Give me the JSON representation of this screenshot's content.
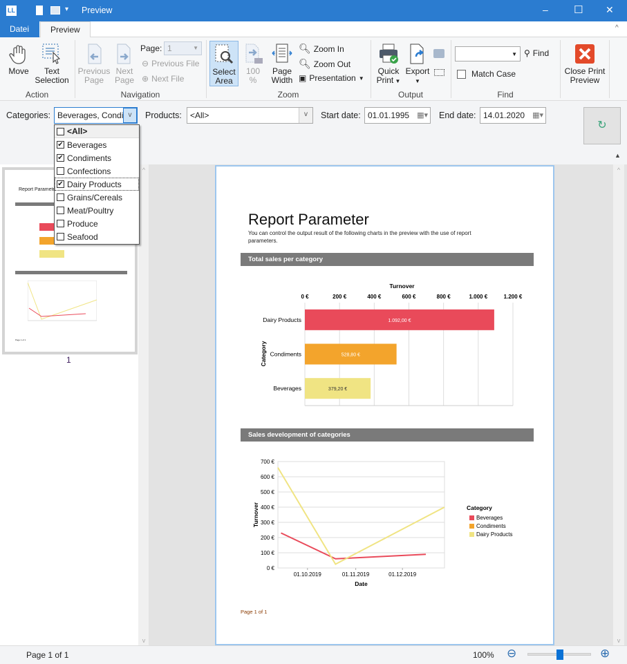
{
  "window": {
    "title": "Preview",
    "minimize": "–",
    "maximize": "☐",
    "close": "✕"
  },
  "tabs": [
    {
      "label": "Datei",
      "active": false
    },
    {
      "label": "Preview",
      "active": true
    }
  ],
  "ribbon": {
    "action": {
      "label": "Action",
      "move": "Move",
      "text_selection": [
        "Text",
        "Selection"
      ]
    },
    "navigation": {
      "label": "Navigation",
      "previous_page": [
        "Previous",
        "Page"
      ],
      "next_page": [
        "Next",
        "Page"
      ],
      "page_label": "Page:",
      "page_value": "1",
      "previous_file": "Previous File",
      "next_file": "Next File"
    },
    "zoom": {
      "label": "Zoom",
      "select_area": [
        "Select",
        "Area"
      ],
      "percent_100": [
        "100",
        "%"
      ],
      "page_width": [
        "Page",
        "Width"
      ],
      "zoom_in": "Zoom In",
      "zoom_out": "Zoom Out",
      "presentation": "Presentation"
    },
    "output": {
      "label": "Output",
      "quick_print": [
        "Quick",
        "Print"
      ],
      "export": [
        "Export",
        ""
      ]
    },
    "find": {
      "label": "Find",
      "find_button": "Find",
      "find_value": "",
      "match_case": "Match Case"
    },
    "close": {
      "label": [
        "Close Print",
        "Preview"
      ]
    }
  },
  "filters": {
    "categories_label": "Categories:",
    "categories_value": "Beverages, Condiments, Dairy Products",
    "products_label": "Products:",
    "products_value": "<All>",
    "start_label": "Start date:",
    "start_value": "01.01.1995",
    "end_label": "End date:",
    "end_value": "14.01.2020",
    "category_options": [
      {
        "label": "<All>",
        "checked": false
      },
      {
        "label": "Beverages",
        "checked": true
      },
      {
        "label": "Condiments",
        "checked": true
      },
      {
        "label": "Confections",
        "checked": false
      },
      {
        "label": "Dairy Products",
        "checked": true
      },
      {
        "label": "Grains/Cereals",
        "checked": false
      },
      {
        "label": "Meat/Poultry",
        "checked": false
      },
      {
        "label": "Produce",
        "checked": false
      },
      {
        "label": "Seafood",
        "checked": false
      }
    ]
  },
  "thumbnail": {
    "page_number": "1"
  },
  "report": {
    "title": "Report Parameter",
    "intro": "You can control the output result of the following charts in the preview with the use of report parameters.",
    "section1": "Total sales per category",
    "section2": "Sales development of categories",
    "footer": "Page 1 of 1"
  },
  "chart_data": [
    {
      "type": "bar",
      "orientation": "horizontal",
      "title": "",
      "xlabel": "Turnover",
      "ylabel": "Category",
      "categories": [
        "Dairy Products",
        "Condiments",
        "Beverages"
      ],
      "values": [
        1092.0,
        528.8,
        379.2
      ],
      "data_labels": [
        "1.092,00 €",
        "528,80 €",
        "379,20 €"
      ],
      "colors": [
        "#e94a5a",
        "#f3a42c",
        "#f0e483"
      ],
      "xlim": [
        0,
        1200
      ],
      "ticks": [
        "0 €",
        "200 €",
        "400 €",
        "600 €",
        "800 €",
        "1.000 €",
        "1.200 €"
      ],
      "grid": true
    },
    {
      "type": "line",
      "title": "",
      "xlabel": "Date",
      "ylabel": "Turnover",
      "xlim": [
        "12.09.2019",
        "28.12.2019"
      ],
      "ylim": [
        0,
        700
      ],
      "xticks": [
        "01.10.2019",
        "01.11.2019",
        "01.12.2019"
      ],
      "yticks": [
        "0 €",
        "100 €",
        "200 €",
        "300 €",
        "400 €",
        "500 €",
        "600 €",
        "700 €"
      ],
      "legend_title": "Category",
      "legend": "right",
      "grid": true,
      "series": [
        {
          "name": "Beverages",
          "color": "#e94a5a",
          "points": [
            [
              "14.09.2019",
              230
            ],
            [
              "19.10.2019",
              60
            ],
            [
              "16.12.2019",
              90
            ]
          ]
        },
        {
          "name": "Condiments",
          "color": "#f3a42c",
          "points": []
        },
        {
          "name": "Dairy Products",
          "color": "#f0e483",
          "points": [
            [
              "12.09.2019",
              660
            ],
            [
              "19.10.2019",
              25
            ],
            [
              "28.12.2019",
              400
            ]
          ]
        }
      ]
    }
  ],
  "status": {
    "page": "Page 1 of 1",
    "zoom": "100%",
    "zoom_level": 100
  }
}
